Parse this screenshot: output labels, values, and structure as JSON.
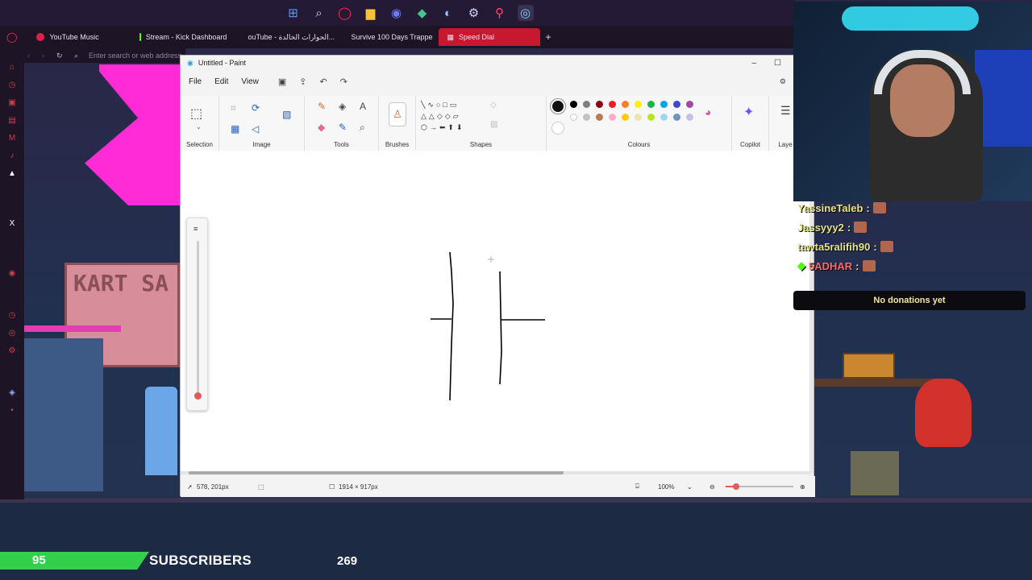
{
  "taskbar": {
    "icons": [
      "windows-start-icon",
      "search-icon",
      "opera-icon",
      "file-explorer-icon",
      "discord-icon",
      "game-icon",
      "steam-icon",
      "settings-icon",
      "maps-icon",
      "browser-icon"
    ]
  },
  "browser": {
    "tabs": [
      {
        "label": "YouTube Music",
        "color": "#e0204a"
      },
      {
        "label": "Stream - Kick Dashboard",
        "color": "#53fc18"
      },
      {
        "label": "ouTube - الحوارات الخالدة...",
        "color": "#e0204a"
      },
      {
        "label": "Survive 100 Days Trappe",
        "color": "#e0204a"
      },
      {
        "label": "Speed Dial",
        "color": "#ffffff"
      }
    ],
    "address_placeholder": "Enter search or web address"
  },
  "paint": {
    "title": "Untitled - Paint",
    "menu": [
      "File",
      "Edit",
      "View"
    ],
    "groups": {
      "selection": "Selection",
      "image": "Image",
      "tools": "Tools",
      "brushes": "Brushes",
      "shapes": "Shapes",
      "colours": "Colours",
      "copilot": "Copilot",
      "layers": "Laye"
    },
    "palette": [
      "#000000",
      "#7f7f7f",
      "#880015",
      "#ed1c24",
      "#ff7f27",
      "#fff200",
      "#22b14c",
      "#00a2e8",
      "#3f48cc",
      "#a349a4",
      "#ffffff",
      "#c3c3c3",
      "#b97a57",
      "#ffaec9",
      "#ffc90e",
      "#efe4b0",
      "#b5e61d",
      "#99d9ea",
      "#7092be",
      "#c8bfe7"
    ],
    "status": {
      "cursor_pos": "578, 201px",
      "canvas_size": "1914 × 917px",
      "zoom": "100%"
    }
  },
  "stream": {
    "chat": [
      {
        "user": "YassineTaleb",
        "color": "#e6e68a"
      },
      {
        "user": "Jassyyy2",
        "color": "#e6e68a"
      },
      {
        "user": "tawta5ralifih90",
        "color": "#e6e68a"
      },
      {
        "user": "5ADHAR",
        "color": "#ff6a6a"
      }
    ],
    "donations": "No donations yet",
    "subscribers_count": "95",
    "subscribers_label": "SUBSCRIBERS",
    "subscribers_goal": "269"
  }
}
